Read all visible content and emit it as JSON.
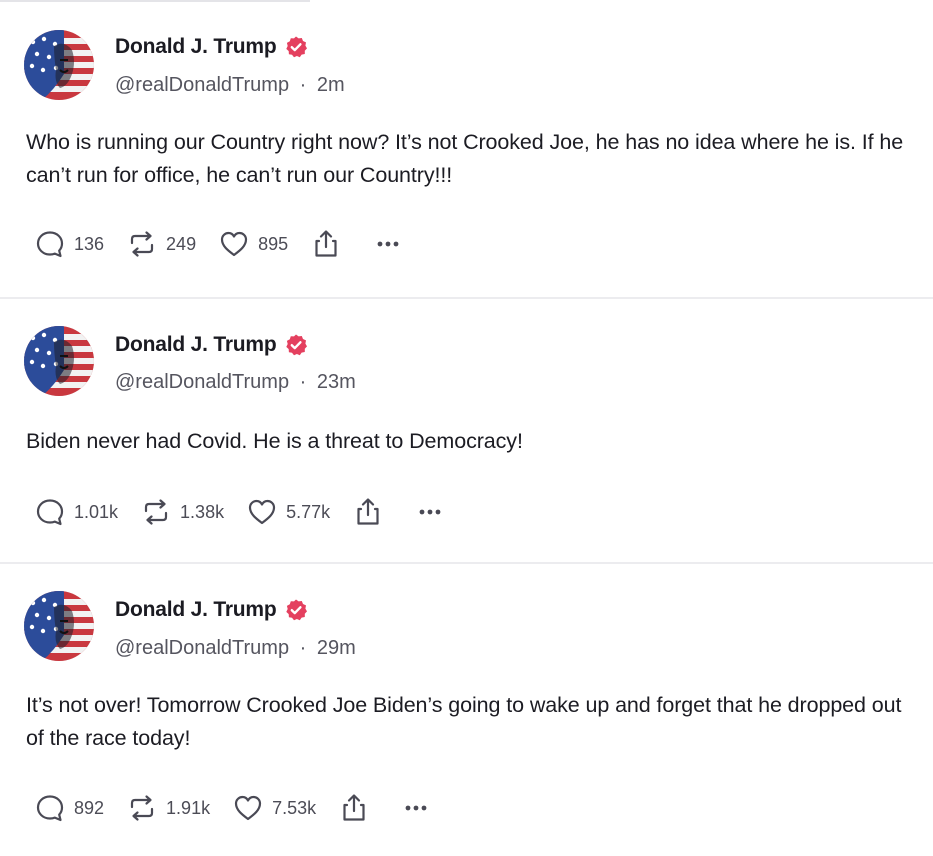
{
  "posts": [
    {
      "author": {
        "name": "Donald J. Trump",
        "handle": "@realDonaldTrump"
      },
      "age": "2m",
      "separator": "·",
      "text": "Who is running our Country right now? It’s not Crooked Joe, he has no idea where he is. If he can’t run for office, he can’t run our Country!!!",
      "replies": "136",
      "reposts": "249",
      "likes": "895"
    },
    {
      "author": {
        "name": "Donald J. Trump",
        "handle": "@realDonaldTrump"
      },
      "age": "23m",
      "separator": "·",
      "text": "Biden never had Covid. He is a threat to Democracy!",
      "replies": "1.01k",
      "reposts": "1.38k",
      "likes": "5.77k"
    },
    {
      "author": {
        "name": "Donald J. Trump",
        "handle": "@realDonaldTrump"
      },
      "age": "29m",
      "separator": "·",
      "text": "It’s not over! Tomorrow Crooked Joe Biden’s going to wake up and forget that he dropped out of the race today!",
      "replies": "892",
      "reposts": "1.91k",
      "likes": "7.53k"
    }
  ],
  "icons": {
    "verified": "verified-badge-icon",
    "reply": "speech-bubble-icon",
    "repost": "repost-arrows-icon",
    "like": "heart-icon",
    "share": "share-upload-icon",
    "more": "ellipsis-icon"
  },
  "colors": {
    "verified_badge": "#e4405f",
    "icon_stroke": "#4a4a55",
    "text": "#1c1c23",
    "muted": "#55555f"
  }
}
